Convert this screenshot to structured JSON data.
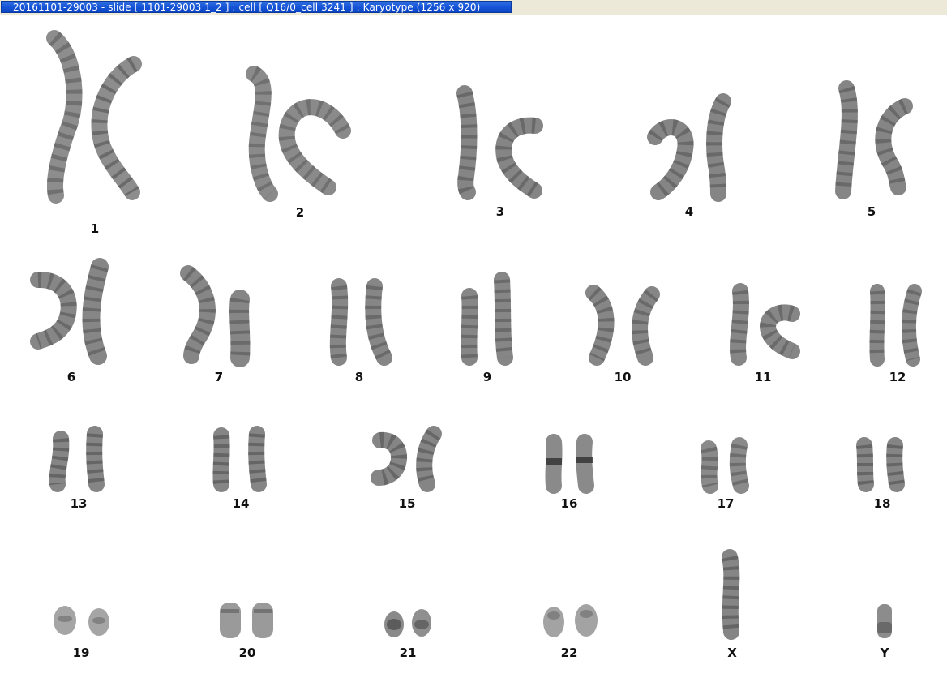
{
  "window": {
    "title": "20161101-29003 - slide [ 1101-29003 1_2 ] : cell [ Q16/0_cell 3241 ] : Karyotype  (1256 x 920)"
  },
  "colors": {
    "title_bar": "#1553d6",
    "chromosome_dark": "#3a3a3a",
    "chromosome_light": "#d8d8d8",
    "label": "#111111"
  },
  "karyotype": {
    "labels": {
      "c1": "1",
      "c2": "2",
      "c3": "3",
      "c4": "4",
      "c5": "5",
      "c6": "6",
      "c7": "7",
      "c8": "8",
      "c9": "9",
      "c10": "10",
      "c11": "11",
      "c12": "12",
      "c13": "13",
      "c14": "14",
      "c15": "15",
      "c16": "16",
      "c17": "17",
      "c18": "18",
      "c19": "19",
      "c20": "20",
      "c21": "21",
      "c22": "22",
      "cX": "X",
      "cY": "Y"
    }
  }
}
